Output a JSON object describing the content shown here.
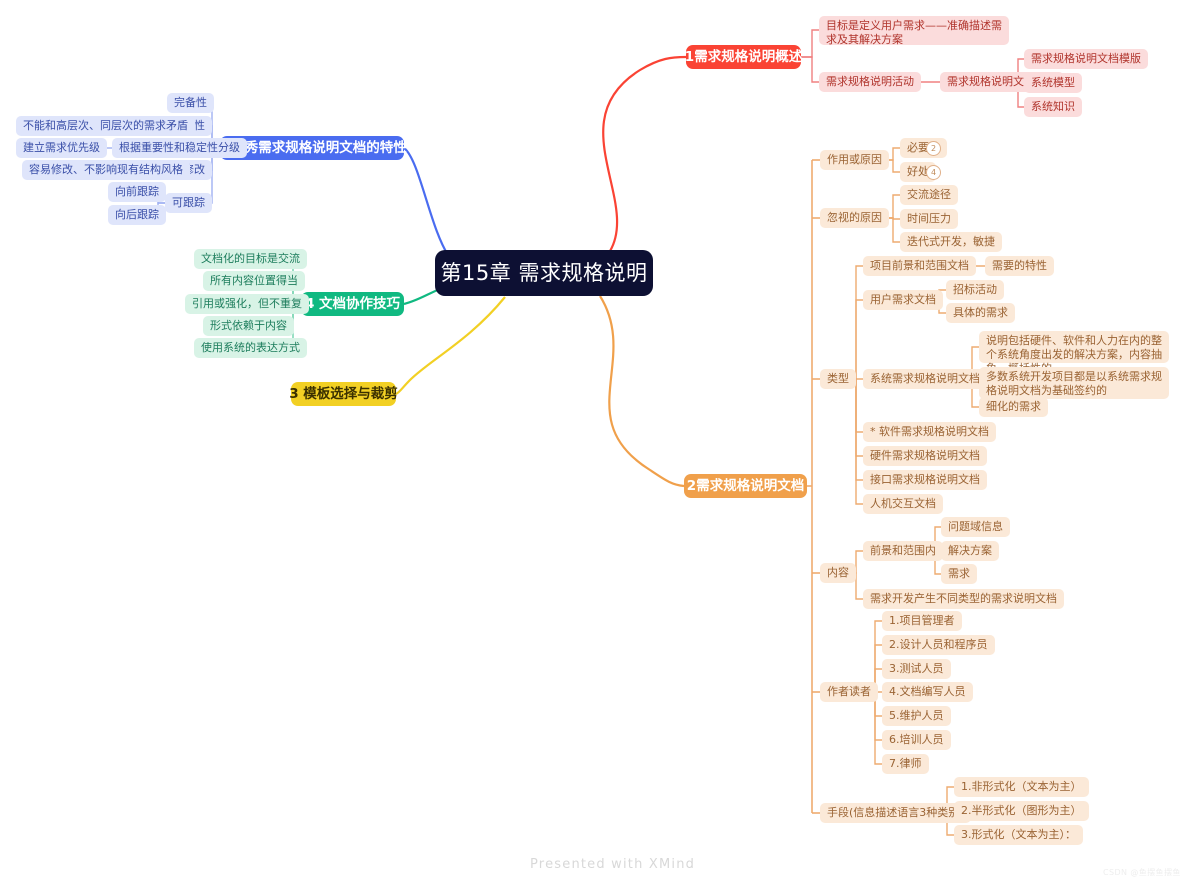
{
  "meta": {
    "app": "XMind",
    "watermark": "Presented with XMind",
    "watermark_corner": "CSDN @鱼摆鱼摆鱼"
  },
  "colors": {
    "central_bg": "#0d1033",
    "red": "#fa4334",
    "orange": "#f0a04b",
    "yellow": "#f2d024",
    "green": "#10b981",
    "blue": "#4a6cf0"
  },
  "central": {
    "label": "第15章 需求规格说明"
  },
  "branches": {
    "b1": {
      "label": "1需求规格说明概述",
      "color": "red",
      "children": [
        {
          "label": "目标是定义用户需求——准确描述需求及其解决方案"
        },
        {
          "label": "需求规格说明活动",
          "children": [
            {
              "label": "需求规格说明文档模版",
              "children": [
                {
                  "label": "需求规格说明文档模版"
                },
                {
                  "label": "系统模型"
                },
                {
                  "label": "系统知识"
                }
              ]
            }
          ]
        }
      ]
    },
    "b2": {
      "label": "2需求规格说明文档",
      "color": "orange",
      "children": [
        {
          "label": "作用或原因",
          "children": [
            {
              "label": "必要性",
              "count": "2"
            },
            {
              "label": "好处",
              "count": "4"
            }
          ]
        },
        {
          "label": "忽视的原因",
          "children": [
            {
              "label": "交流途径"
            },
            {
              "label": "时间压力"
            },
            {
              "label": "迭代式开发，敏捷"
            }
          ]
        },
        {
          "label": "类型",
          "children": [
            {
              "label": "项目前景和范围文档",
              "children": [
                {
                  "label": "需要的特性"
                }
              ]
            },
            {
              "label": "用户需求文档",
              "children": [
                {
                  "label": "招标活动"
                },
                {
                  "label": "具体的需求"
                }
              ]
            },
            {
              "label": "系统需求规格说明文档",
              "children": [
                {
                  "label": "说明包括硬件、软件和人力在内的整个系统角度出发的解决方案，内容抽象，概括性的。"
                },
                {
                  "label": "多数系统开发项目都是以系统需求规格说明文档为基础签约的"
                },
                {
                  "label": "细化的需求"
                }
              ]
            },
            {
              "label": "* 软件需求规格说明文档"
            },
            {
              "label": "硬件需求规格说明文档"
            },
            {
              "label": "接口需求规格说明文档"
            },
            {
              "label": "人机交互文档"
            }
          ]
        },
        {
          "label": "内容",
          "children": [
            {
              "label": "前景和范围内",
              "children": [
                {
                  "label": "问题域信息"
                },
                {
                  "label": "解决方案"
                },
                {
                  "label": "需求"
                }
              ]
            },
            {
              "label": "需求开发产生不同类型的需求说明文档"
            }
          ]
        },
        {
          "label": "作者读者",
          "children": [
            {
              "label": "1.项目管理者"
            },
            {
              "label": "2.设计人员和程序员"
            },
            {
              "label": "3.测试人员"
            },
            {
              "label": "4.文档编写人员"
            },
            {
              "label": "5.维护人员"
            },
            {
              "label": "6.培训人员"
            },
            {
              "label": "7.律师"
            }
          ]
        },
        {
          "label": "手段(信息描述语言3种类别)",
          "children": [
            {
              "label": "1.非形式化（文本为主）"
            },
            {
              "label": "2.半形式化（图形为主）"
            },
            {
              "label": "3.形式化（文本为主）："
            }
          ]
        }
      ]
    },
    "b3": {
      "label": "3 模板选择与裁剪",
      "color": "yellow",
      "children": []
    },
    "b4": {
      "label": "4 文档协作技巧",
      "color": "green",
      "children": [
        {
          "label": "文档化的目标是交流"
        },
        {
          "label": "所有内容位置得当"
        },
        {
          "label": "引用或强化，但不重复"
        },
        {
          "label": "形式依赖于内容"
        },
        {
          "label": "使用系统的表达方式"
        }
      ]
    },
    "b5": {
      "label": "5 优秀需求规格说明文档的特性",
      "color": "blue",
      "children": [
        {
          "label": "完备性"
        },
        {
          "label": "一致性",
          "children": [
            {
              "label": "不能和高层次、同层次的需求矛盾"
            }
          ]
        },
        {
          "label": "根据重要性和稳定性分级",
          "children": [
            {
              "label": "建立需求优先级"
            }
          ]
        },
        {
          "label": "可修改",
          "children": [
            {
              "label": "容易修改、不影响现有结构风格"
            }
          ]
        },
        {
          "label": "可跟踪",
          "children": [
            {
              "label": "向前跟踪"
            },
            {
              "label": "向后跟踪"
            }
          ]
        }
      ]
    }
  }
}
